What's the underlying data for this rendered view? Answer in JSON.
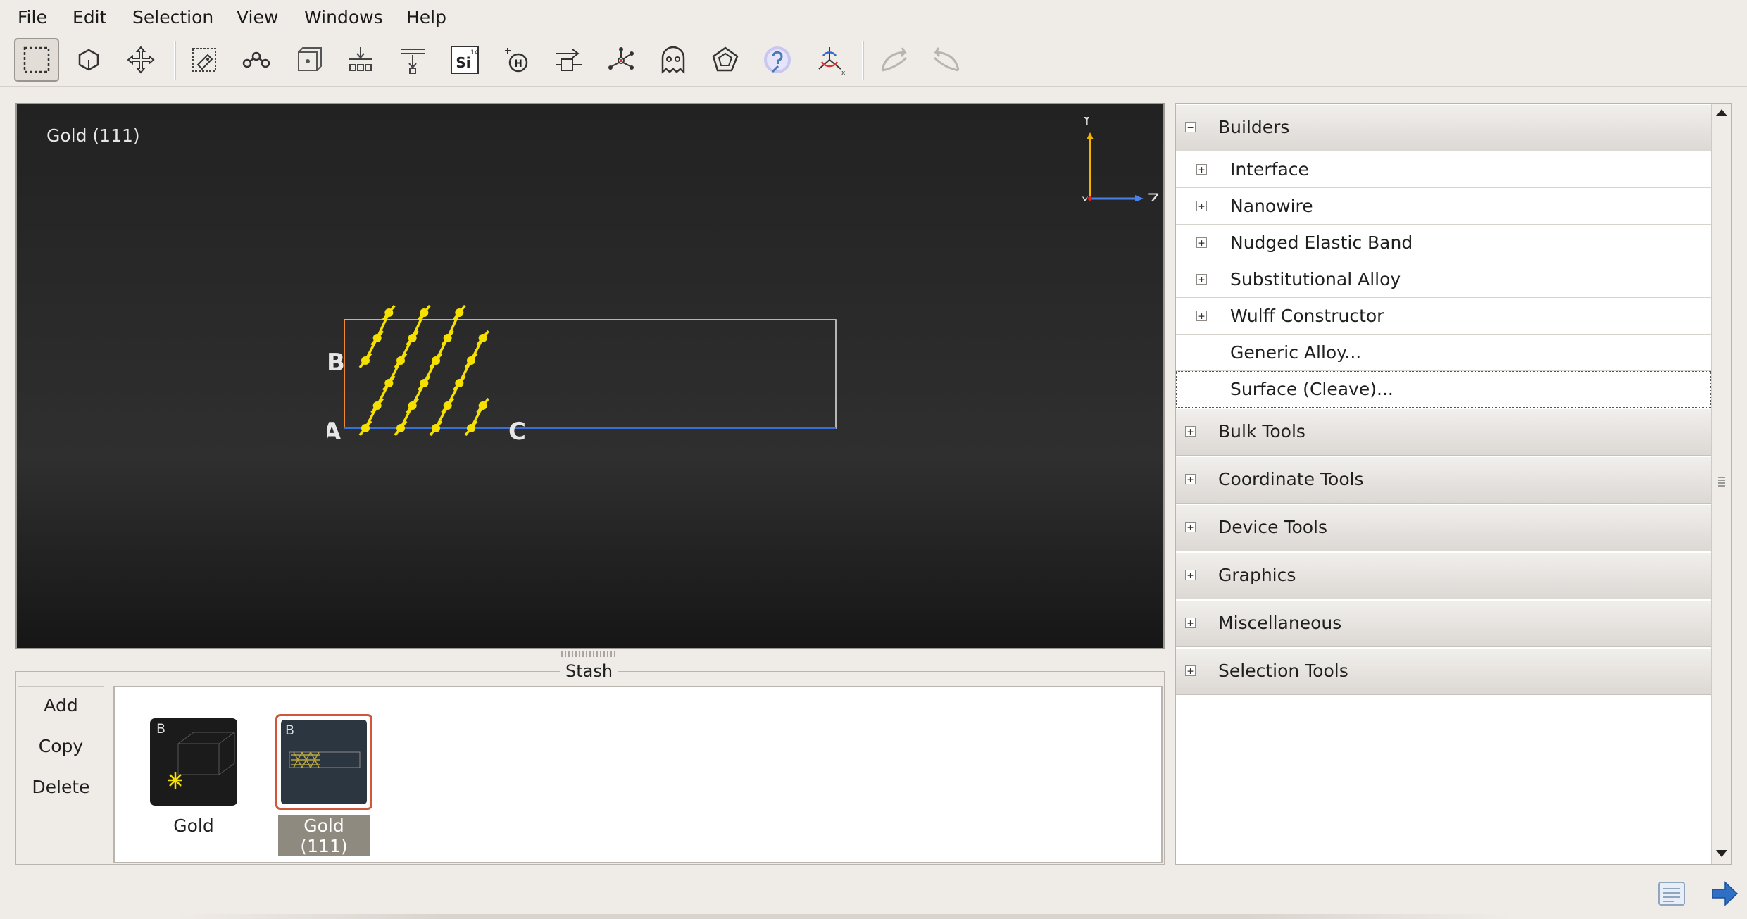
{
  "menu": [
    "File",
    "Edit",
    "Selection",
    "View",
    "Windows",
    "Help"
  ],
  "toolbar": {
    "tools": [
      "select-rectangle-icon",
      "polyhedron-icon",
      "move-icon",
      "bond-tag-icon",
      "bond-icon",
      "lattice-icon",
      "center-icon",
      "center-vertical-icon",
      "element-si-icon",
      "hydrogen-icon",
      "export-icon",
      "molecule-icon",
      "ghost-icon",
      "rotate-cell-icon",
      "help-icon",
      "axes-icon",
      "undo-icon",
      "redo-icon"
    ],
    "element_symbol": "Si",
    "element_number": "14",
    "hydrogen_symbol": "H"
  },
  "viewer": {
    "title": "Gold (111)",
    "axes": {
      "y": "Y",
      "z": "Z",
      "x": "X"
    },
    "cell_labels": {
      "a": "A",
      "b": "B",
      "c": "C"
    },
    "colors": {
      "atoms": "#f5e000",
      "cell_a": "#f08a30",
      "cell_c": "#3b6fd8"
    }
  },
  "stash": {
    "title": "Stash",
    "buttons": [
      "Add",
      "Copy",
      "Delete"
    ],
    "items": [
      {
        "label": "Gold",
        "badge": "B",
        "selected": false
      },
      {
        "label": "Gold (111)",
        "badge": "B",
        "selected": true
      }
    ]
  },
  "panel": {
    "builders": {
      "label": "Builders",
      "expanded": true,
      "items": [
        {
          "label": "Interface",
          "expandable": true
        },
        {
          "label": "Nanowire",
          "expandable": true
        },
        {
          "label": "Nudged Elastic Band",
          "expandable": true
        },
        {
          "label": "Substitutional Alloy",
          "expandable": true
        },
        {
          "label": "Wulff Constructor",
          "expandable": true
        },
        {
          "label": "Generic Alloy...",
          "expandable": false
        },
        {
          "label": "Surface (Cleave)...",
          "expandable": false
        }
      ]
    },
    "categories": [
      "Bulk Tools",
      "Coordinate Tools",
      "Device Tools",
      "Graphics",
      "Miscellaneous",
      "Selection Tools"
    ]
  }
}
